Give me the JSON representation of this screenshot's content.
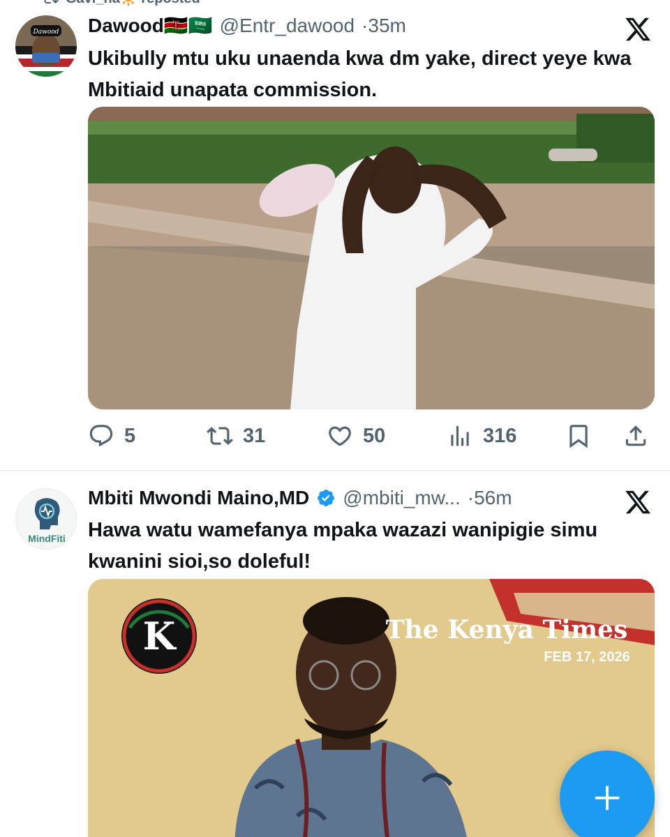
{
  "repost_banner": {
    "text": "Gavi_ha🔆 reposted"
  },
  "tweets": [
    {
      "display_name": "Dawood🇰🇪🇸🇦",
      "handle": "@Entr_dawood",
      "separator": "·",
      "time": "35m",
      "text": "Ukibully mtu uku unaenda kwa dm yake, direct yeye kwa Mbitiaid unapata commission.",
      "avatar_label": "Dawood",
      "actions": {
        "replies": "5",
        "reposts": "31",
        "likes": "50",
        "views": "316"
      }
    },
    {
      "display_name": "Mbiti Mwondi Maino,MD",
      "verified": true,
      "handle": "@mbiti_mw...",
      "separator": "·",
      "time": "56m",
      "text": "Hawa watu wamefanya mpaka wazazi wanipigie simu kwanini sioi,so doleful!",
      "avatar_label": "MindFiti",
      "media_overlay": {
        "logo_letter": "K",
        "masthead": "The Kenya Times",
        "date": "FEB 17, 2026"
      }
    }
  ],
  "colors": {
    "accent": "#1d9bf0",
    "secondary_text": "#536471",
    "primary_text": "#0f1419"
  },
  "icons": [
    "repost-icon",
    "x-logo-icon",
    "reply-icon",
    "like-icon",
    "views-icon",
    "bookmark-icon",
    "share-icon",
    "verified-icon",
    "plus-icon"
  ]
}
